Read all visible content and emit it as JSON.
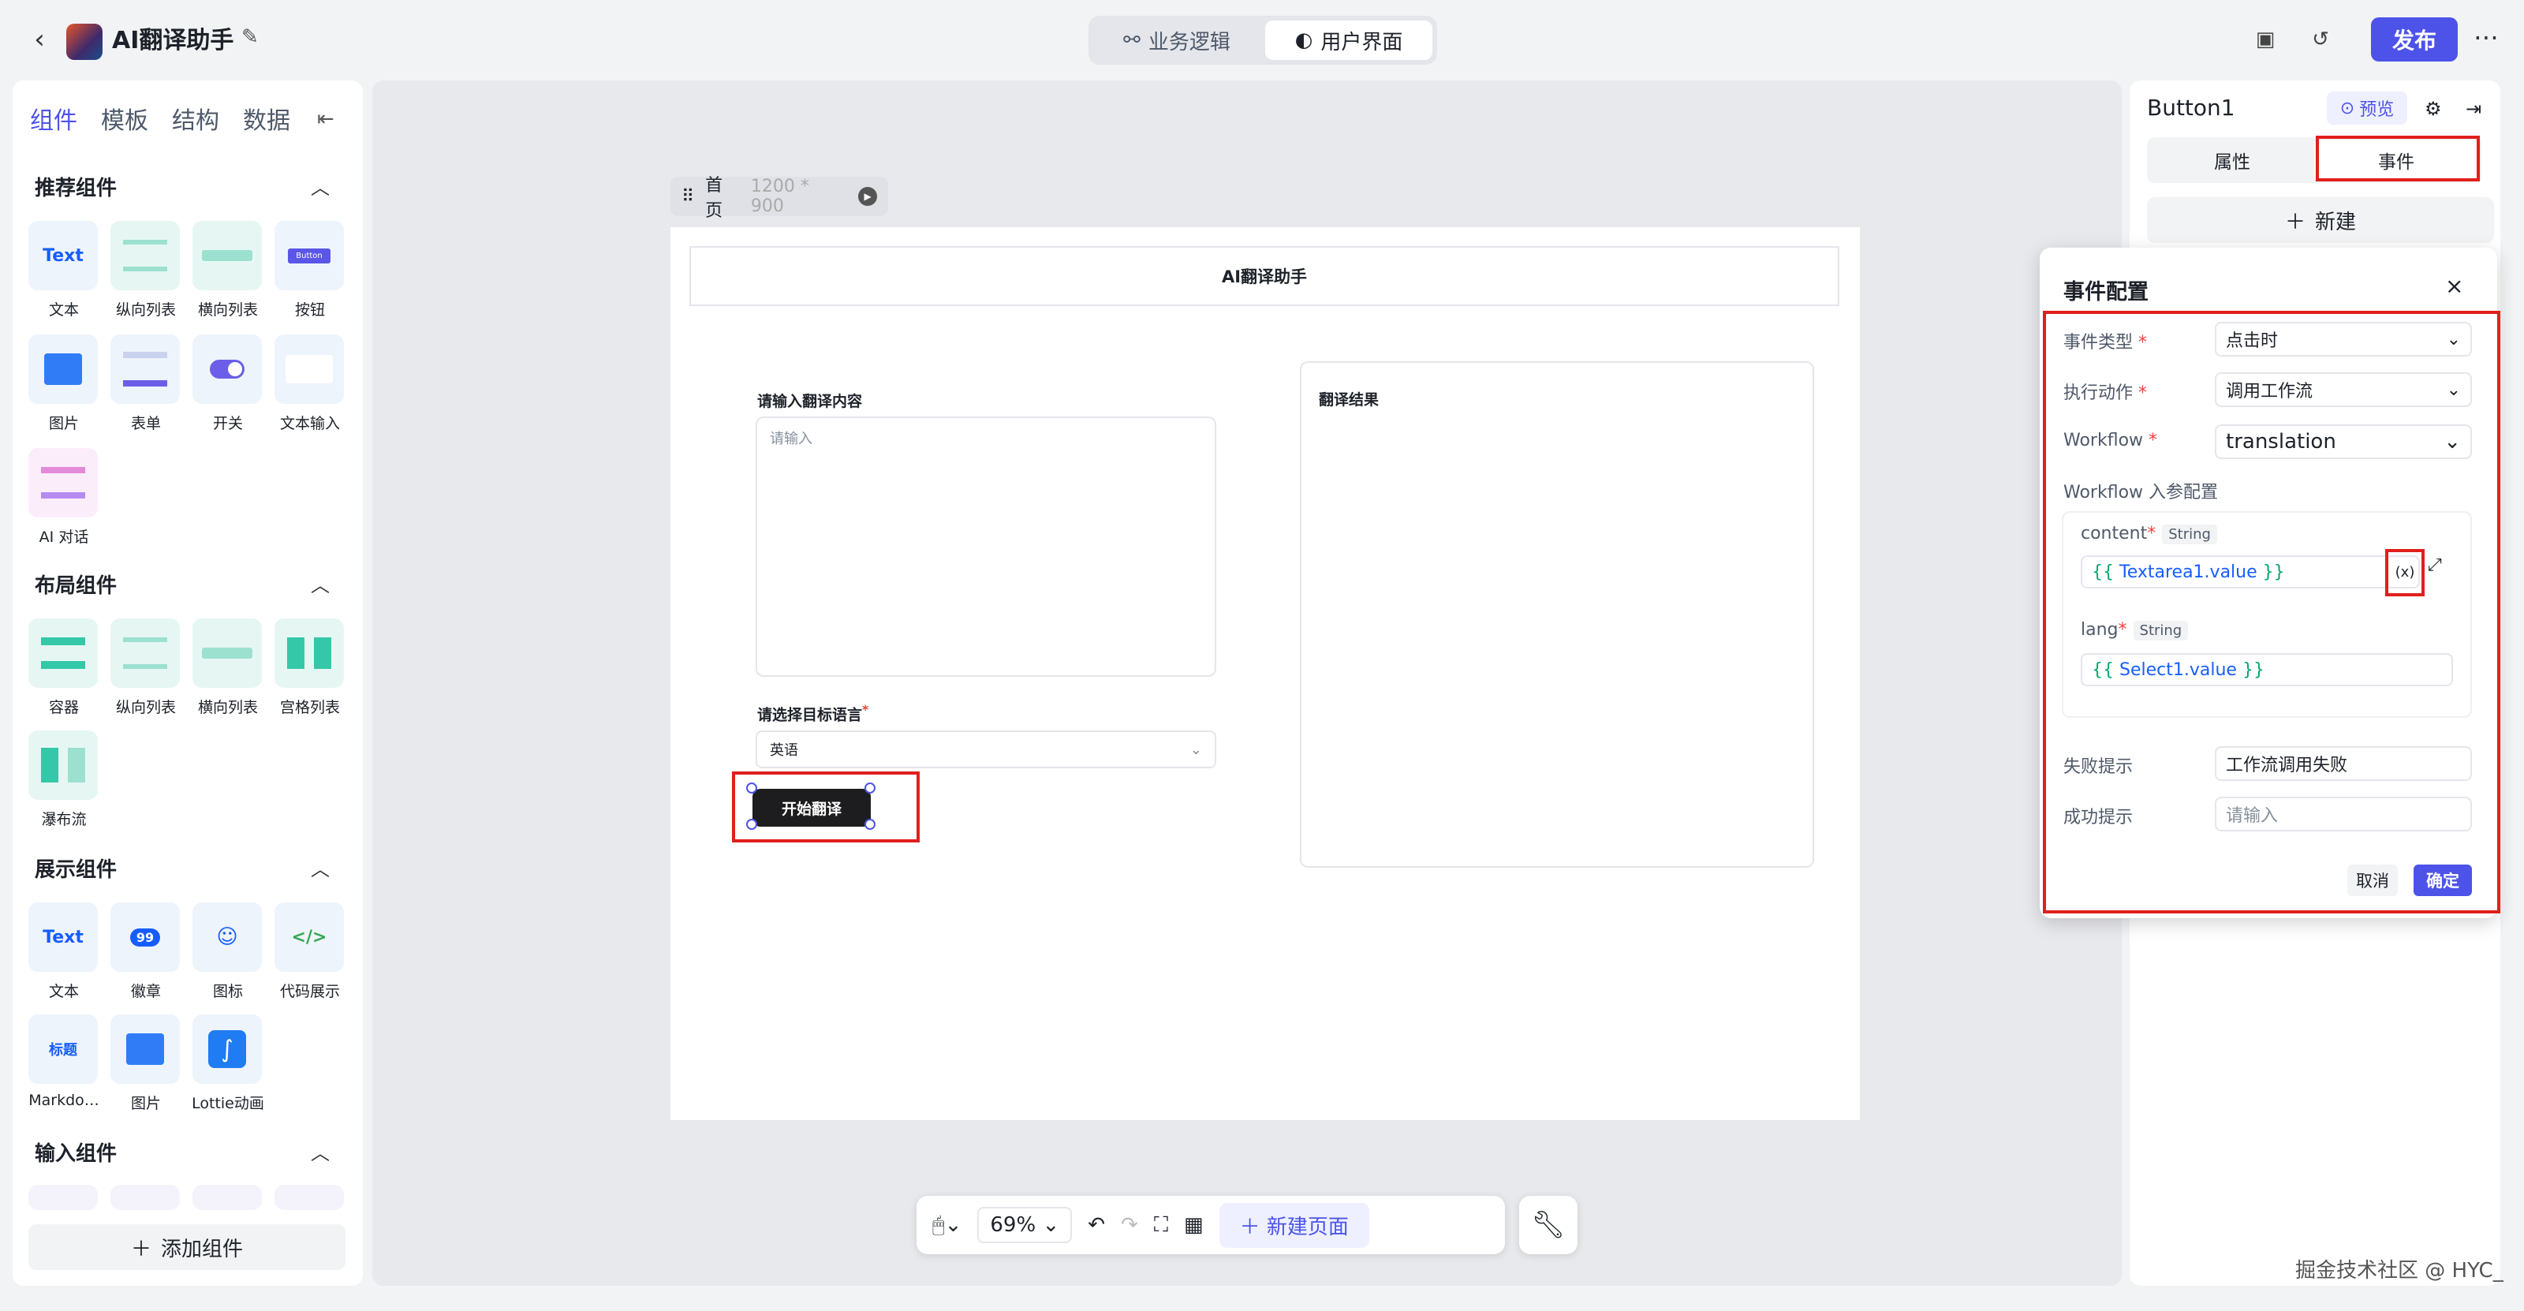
{
  "header": {
    "app_title": "AI翻译助手",
    "tabs": [
      {
        "label": "业务逻辑"
      },
      {
        "label": "用户界面"
      }
    ],
    "publish_label": "发布"
  },
  "left_panel": {
    "tabs": [
      "组件",
      "模板",
      "结构",
      "数据"
    ],
    "sections": {
      "recommended": {
        "title": "推荐组件",
        "items": [
          "文本",
          "纵向列表",
          "横向列表",
          "按钮",
          "图片",
          "表单",
          "开关",
          "文本输入",
          "AI 对话"
        ]
      },
      "layout": {
        "title": "布局组件",
        "items": [
          "容器",
          "纵向列表",
          "横向列表",
          "宫格列表",
          "瀑布流"
        ]
      },
      "display": {
        "title": "展示组件",
        "items": [
          "文本",
          "徽章",
          "图标",
          "代码展示",
          "Markdo…",
          "图片",
          "Lottie动画"
        ]
      },
      "input": {
        "title": "输入组件"
      }
    },
    "icon_texts": {
      "text": "Text",
      "button": "Button",
      "badge": "99",
      "md_title": "标题"
    },
    "add_component_label": "添加组件"
  },
  "canvas": {
    "page_name": "首页",
    "page_size": "1200 * 900",
    "app_header": "AI翻译助手",
    "input_label": "请输入翻译内容",
    "input_placeholder": "请输入",
    "lang_label": "请选择目标语言",
    "lang_value": "英语",
    "start_button": "开始翻译",
    "result_label": "翻译结果"
  },
  "bottom_toolbar": {
    "zoom": "69%",
    "new_page_label": "新建页面"
  },
  "right_panel": {
    "component_name": "Button1",
    "preview_label": "预览",
    "tabs": [
      "属性",
      "事件"
    ],
    "new_label": "新建"
  },
  "event_dialog": {
    "title": "事件配置",
    "event_type_label": "事件类型",
    "event_type_value": "点击时",
    "action_label": "执行动作",
    "action_value": "调用工作流",
    "workflow_label": "Workflow",
    "workflow_value": "translation",
    "params_title": "Workflow 入参配置",
    "param1_name": "content",
    "param1_type": "String",
    "param1_open": "{{",
    "param1_var": "Textarea1.value",
    "param1_close": "}}",
    "param2_name": "lang",
    "param2_type": "String",
    "param2_open": "{{",
    "param2_var": "Select1.value",
    "param2_close": "}}",
    "fail_label": "失败提示",
    "fail_value": "工作流调用失败",
    "success_label": "成功提示",
    "success_placeholder": "请输入",
    "cancel_label": "取消",
    "confirm_label": "确定",
    "expr_icon_label": "(x)"
  },
  "watermark": "掘金技术社区 @ HYC_",
  "colors": {
    "accent": "#4d53e8",
    "highlight_red": "#e0201c",
    "expr_green": "#00a86b",
    "expr_blue": "#165dff"
  }
}
